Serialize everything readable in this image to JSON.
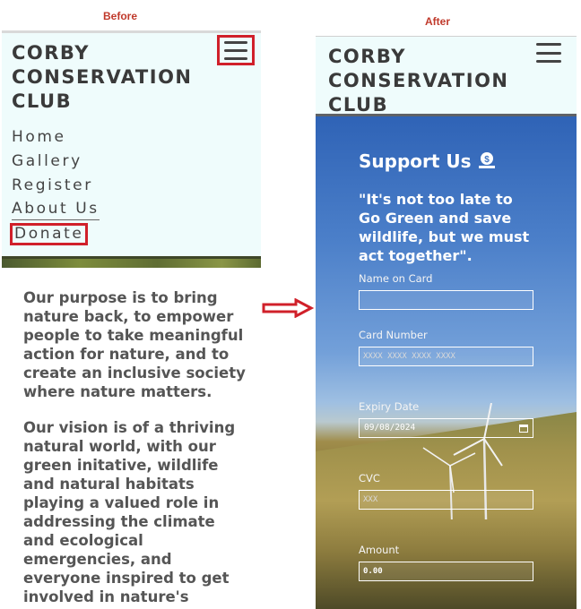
{
  "captions": {
    "before": "Before",
    "after": "After"
  },
  "brand": {
    "line1": "CORBY",
    "line2": "CONSERVATION",
    "line3": "CLUB"
  },
  "nav": {
    "items": [
      {
        "label": "Home"
      },
      {
        "label": "Gallery"
      },
      {
        "label": "Register"
      },
      {
        "label": "About Us"
      },
      {
        "label": "Donate"
      }
    ]
  },
  "before_body": {
    "purpose": "Our purpose is to bring nature back, to empower people to take meaningful action for nature, and to create an inclusive society where nature matters.",
    "vision": "Our vision is of a thriving natural world, with our green initative, wildlife and natural habitats playing a valued role in addressing the climate and ecological emergencies, and everyone inspired to get involved in nature's"
  },
  "donate_form": {
    "title": "Support Us",
    "quote": "\"It's not too late to Go Green and save wildlife, but we must act together\".",
    "name_label": "Name on Card",
    "name_value": "",
    "card_label": "Card Number",
    "card_placeholder": "XXXX XXXX XXXX XXXX",
    "expiry_label": "Expiry Date",
    "expiry_value": "09/08/2024",
    "cvc_label": "CVC",
    "cvc_placeholder": "XXX",
    "amount_label": "Amount",
    "amount_value": "0.00"
  },
  "colors": {
    "highlight": "#d0202a",
    "header_bg": "#effcfc",
    "brand_text": "#3a3a3a"
  },
  "icons": [
    "hamburger-icon",
    "money-icon",
    "calendar-icon",
    "right-arrow-icon"
  ]
}
